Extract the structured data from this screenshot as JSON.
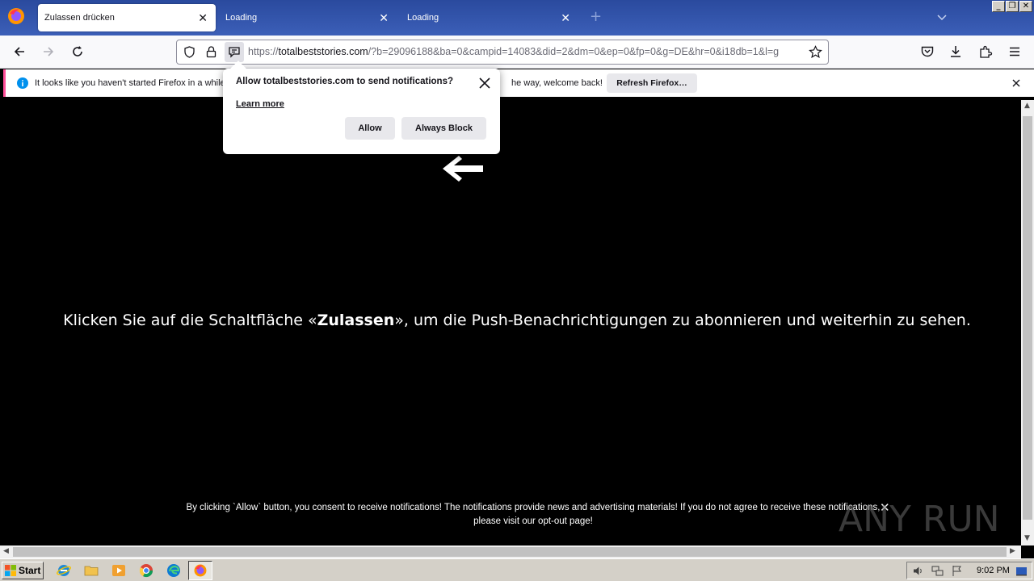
{
  "browser": {
    "tabs": [
      {
        "label": "Zulassen drücken",
        "active": true
      },
      {
        "label": "Loading",
        "active": false
      },
      {
        "label": "Loading",
        "active": false
      }
    ],
    "url_host": "totalbeststories.com",
    "url_prefix": "https://",
    "url_rest": "/?b=29096188&ba=0&campid=14083&did=2&dm=0&ep=0&fp=0&g=DE&hr=0&i18db=1&l=g"
  },
  "notification_bar": {
    "text_start": "It looks like you haven't started Firefox in a while",
    "text_end": "he way, welcome back!",
    "button_label": "Refresh Firefox…"
  },
  "permission_popup": {
    "title": "Allow totalbeststories.com to send notifications?",
    "learn_more": "Learn more",
    "allow_label": "Allow",
    "block_label": "Always Block"
  },
  "page": {
    "headline_pre": "Klicken Sie auf die Schaltfläche «",
    "headline_bold": "Zulassen",
    "headline_post": "», um die Push-Benachrichtigungen zu abonnieren und weiterhin zu sehen.",
    "consent_line1": "By clicking `Allow` button, you consent to receive notifications! The notifications provide news and advertising materials! If you do not agree to receive these notifications,",
    "consent_line2": "please visit our opt-out page!",
    "watermark": "ANY RUN"
  },
  "taskbar": {
    "start_label": "Start",
    "clock": "9:02 PM"
  },
  "colors": {
    "tabstrip": "#2a4a9e",
    "accent_stripe": "#ff4f9a",
    "page_bg": "#000000"
  }
}
